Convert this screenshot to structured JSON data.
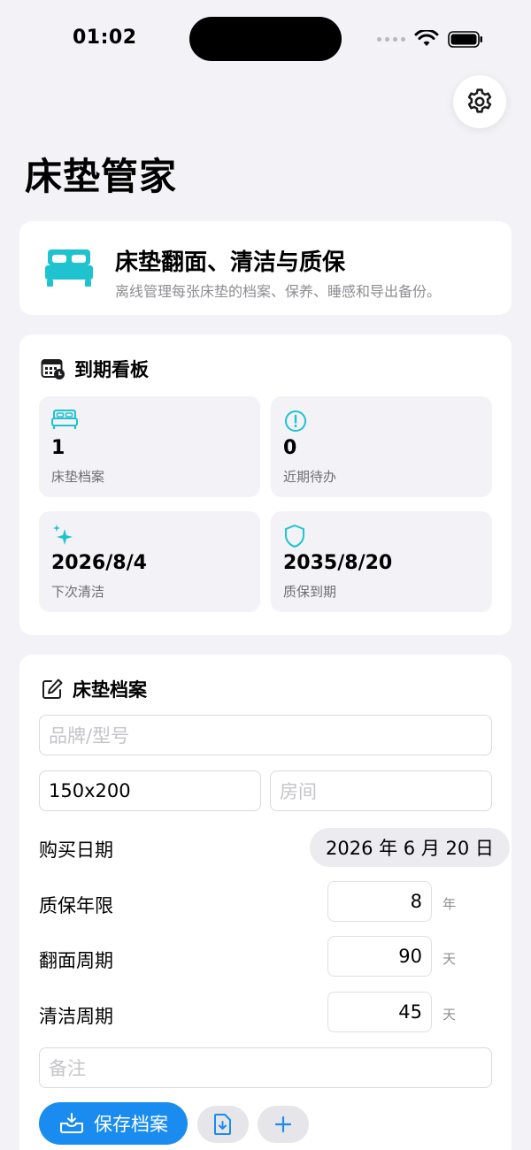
{
  "status": {
    "time": "01:02"
  },
  "header": {
    "title": "床垫管家"
  },
  "hero": {
    "title": "床垫翻面、清洁与质保",
    "subtitle": "离线管理每张床垫的档案、保养、睡感和导出备份。"
  },
  "dashboard": {
    "title": "到期看板",
    "tiles": [
      {
        "value": "1",
        "label": "床垫档案",
        "icon": "bed-icon"
      },
      {
        "value": "0",
        "label": "近期待办",
        "icon": "alert-circle-icon"
      },
      {
        "value": "2026/8/4",
        "label": "下次清洁",
        "icon": "sparkle-icon"
      },
      {
        "value": "2035/8/20",
        "label": "质保到期",
        "icon": "shield-icon"
      }
    ]
  },
  "form": {
    "title": "床垫档案",
    "brand_placeholder": "品牌/型号",
    "size_value": "150x200",
    "room_placeholder": "房间",
    "purchase_label": "购买日期",
    "purchase_value": "2026 年 6 月 20 日",
    "warranty_label": "质保年限",
    "warranty_value": "8",
    "warranty_unit": "年",
    "flip_label": "翻面周期",
    "flip_value": "90",
    "flip_unit": "天",
    "clean_label": "清洁周期",
    "clean_value": "45",
    "clean_unit": "天",
    "note_placeholder": "备注",
    "save_label": "保存档案"
  },
  "colors": {
    "accent": "#1fc3cf",
    "primary_button": "#1a8cf0",
    "background": "#f2f2f7"
  }
}
